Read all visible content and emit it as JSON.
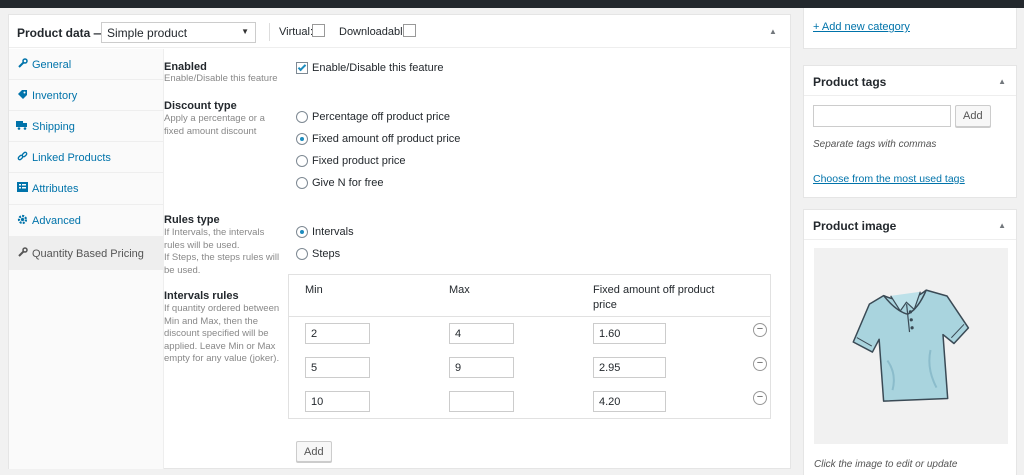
{
  "product_data": {
    "title": "Product data —",
    "type_select": "Simple product",
    "virtual_label": "Virtual:",
    "downloadable_label": "Downloadable:",
    "tabs": [
      {
        "label": "General",
        "icon": "wrench-icon"
      },
      {
        "label": "Inventory",
        "icon": "tag-icon"
      },
      {
        "label": "Shipping",
        "icon": "truck-icon"
      },
      {
        "label": "Linked Products",
        "icon": "link-icon"
      },
      {
        "label": "Attributes",
        "icon": "list-icon"
      },
      {
        "label": "Advanced",
        "icon": "gear-icon"
      },
      {
        "label": "Quantity Based Pricing",
        "icon": "wrench-icon",
        "active": true
      }
    ]
  },
  "fields": {
    "enabled": {
      "label": "Enabled",
      "help": "Enable/Disable this feature",
      "checkbox_label": "Enable/Disable this feature",
      "checked": true
    },
    "discount_type": {
      "label": "Discount type",
      "help": "Apply a percentage or a fixed amount discount",
      "options": [
        {
          "label": "Percentage off product price",
          "selected": false
        },
        {
          "label": "Fixed amount off product price",
          "selected": true
        },
        {
          "label": "Fixed product price",
          "selected": false
        },
        {
          "label": "Give N for free",
          "selected": false
        }
      ]
    },
    "rules_type": {
      "label": "Rules type",
      "help": "If Intervals, the intervals rules will be used.\nIf Steps, the steps rules will be used.",
      "options": [
        {
          "label": "Intervals",
          "selected": true
        },
        {
          "label": "Steps",
          "selected": false
        }
      ]
    },
    "intervals_rules": {
      "label": "Intervals rules",
      "help": "If quantity ordered between Min and Max, then the discount specified will be applied. Leave Min or Max empty for any value (joker).",
      "columns": [
        "Min",
        "Max",
        "Fixed amount off product price"
      ],
      "rows": [
        {
          "min": "2",
          "max": "4",
          "amount": "1.60"
        },
        {
          "min": "5",
          "max": "9",
          "amount": "2.95"
        },
        {
          "min": "10",
          "max": "",
          "amount": "4.20"
        }
      ],
      "remove_symbol": "−",
      "add_button": "Add"
    }
  },
  "sidebar": {
    "add_category": "+ Add new category",
    "tags": {
      "title": "Product tags",
      "input_value": "",
      "add_button": "Add",
      "hint": "Separate tags with commas",
      "choose_link": "Choose from the most used tags"
    },
    "image": {
      "title": "Product image",
      "caption": "Click the image to edit or update"
    }
  },
  "colors": {
    "accent": "#0073aa",
    "checked": "#1e8cbe",
    "shirt": "#a9d4de"
  }
}
